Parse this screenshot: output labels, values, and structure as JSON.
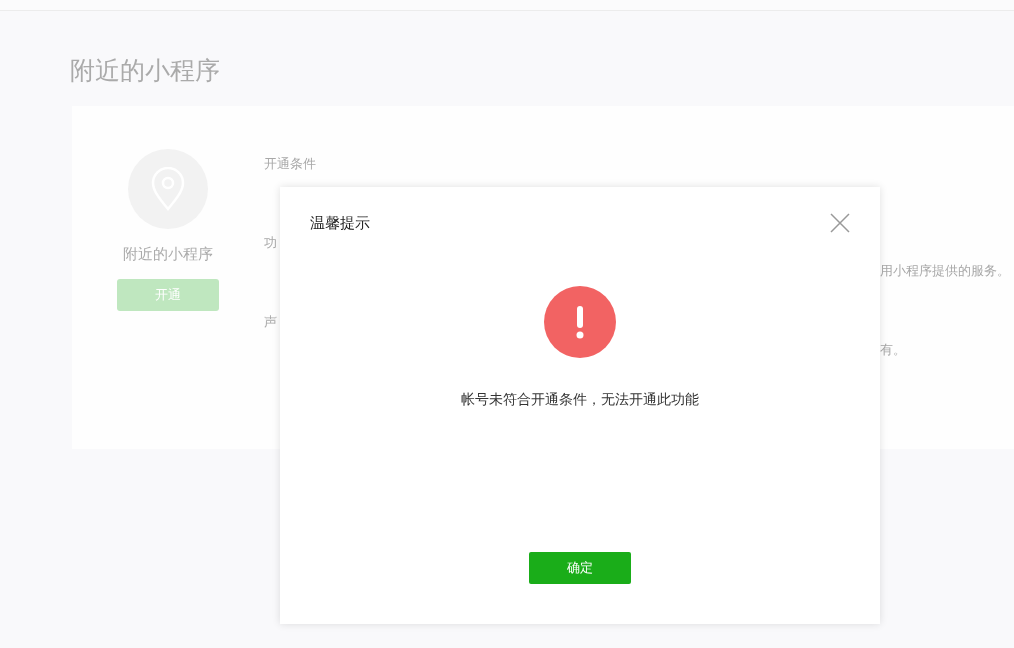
{
  "page": {
    "title": "附近的小程序"
  },
  "feature": {
    "name": "附近的小程序",
    "button": "开通",
    "disabled": true
  },
  "details": [
    {
      "left": "开通条件"
    },
    {
      "left": "功",
      "right": "用小程序提供的服务。"
    },
    {
      "left": "声",
      "right": "有。"
    }
  ],
  "dialog": {
    "title": "温馨提示",
    "kind": "error",
    "message": "帐号未符合开通条件，无法开通此功能",
    "confirm": "确定"
  }
}
